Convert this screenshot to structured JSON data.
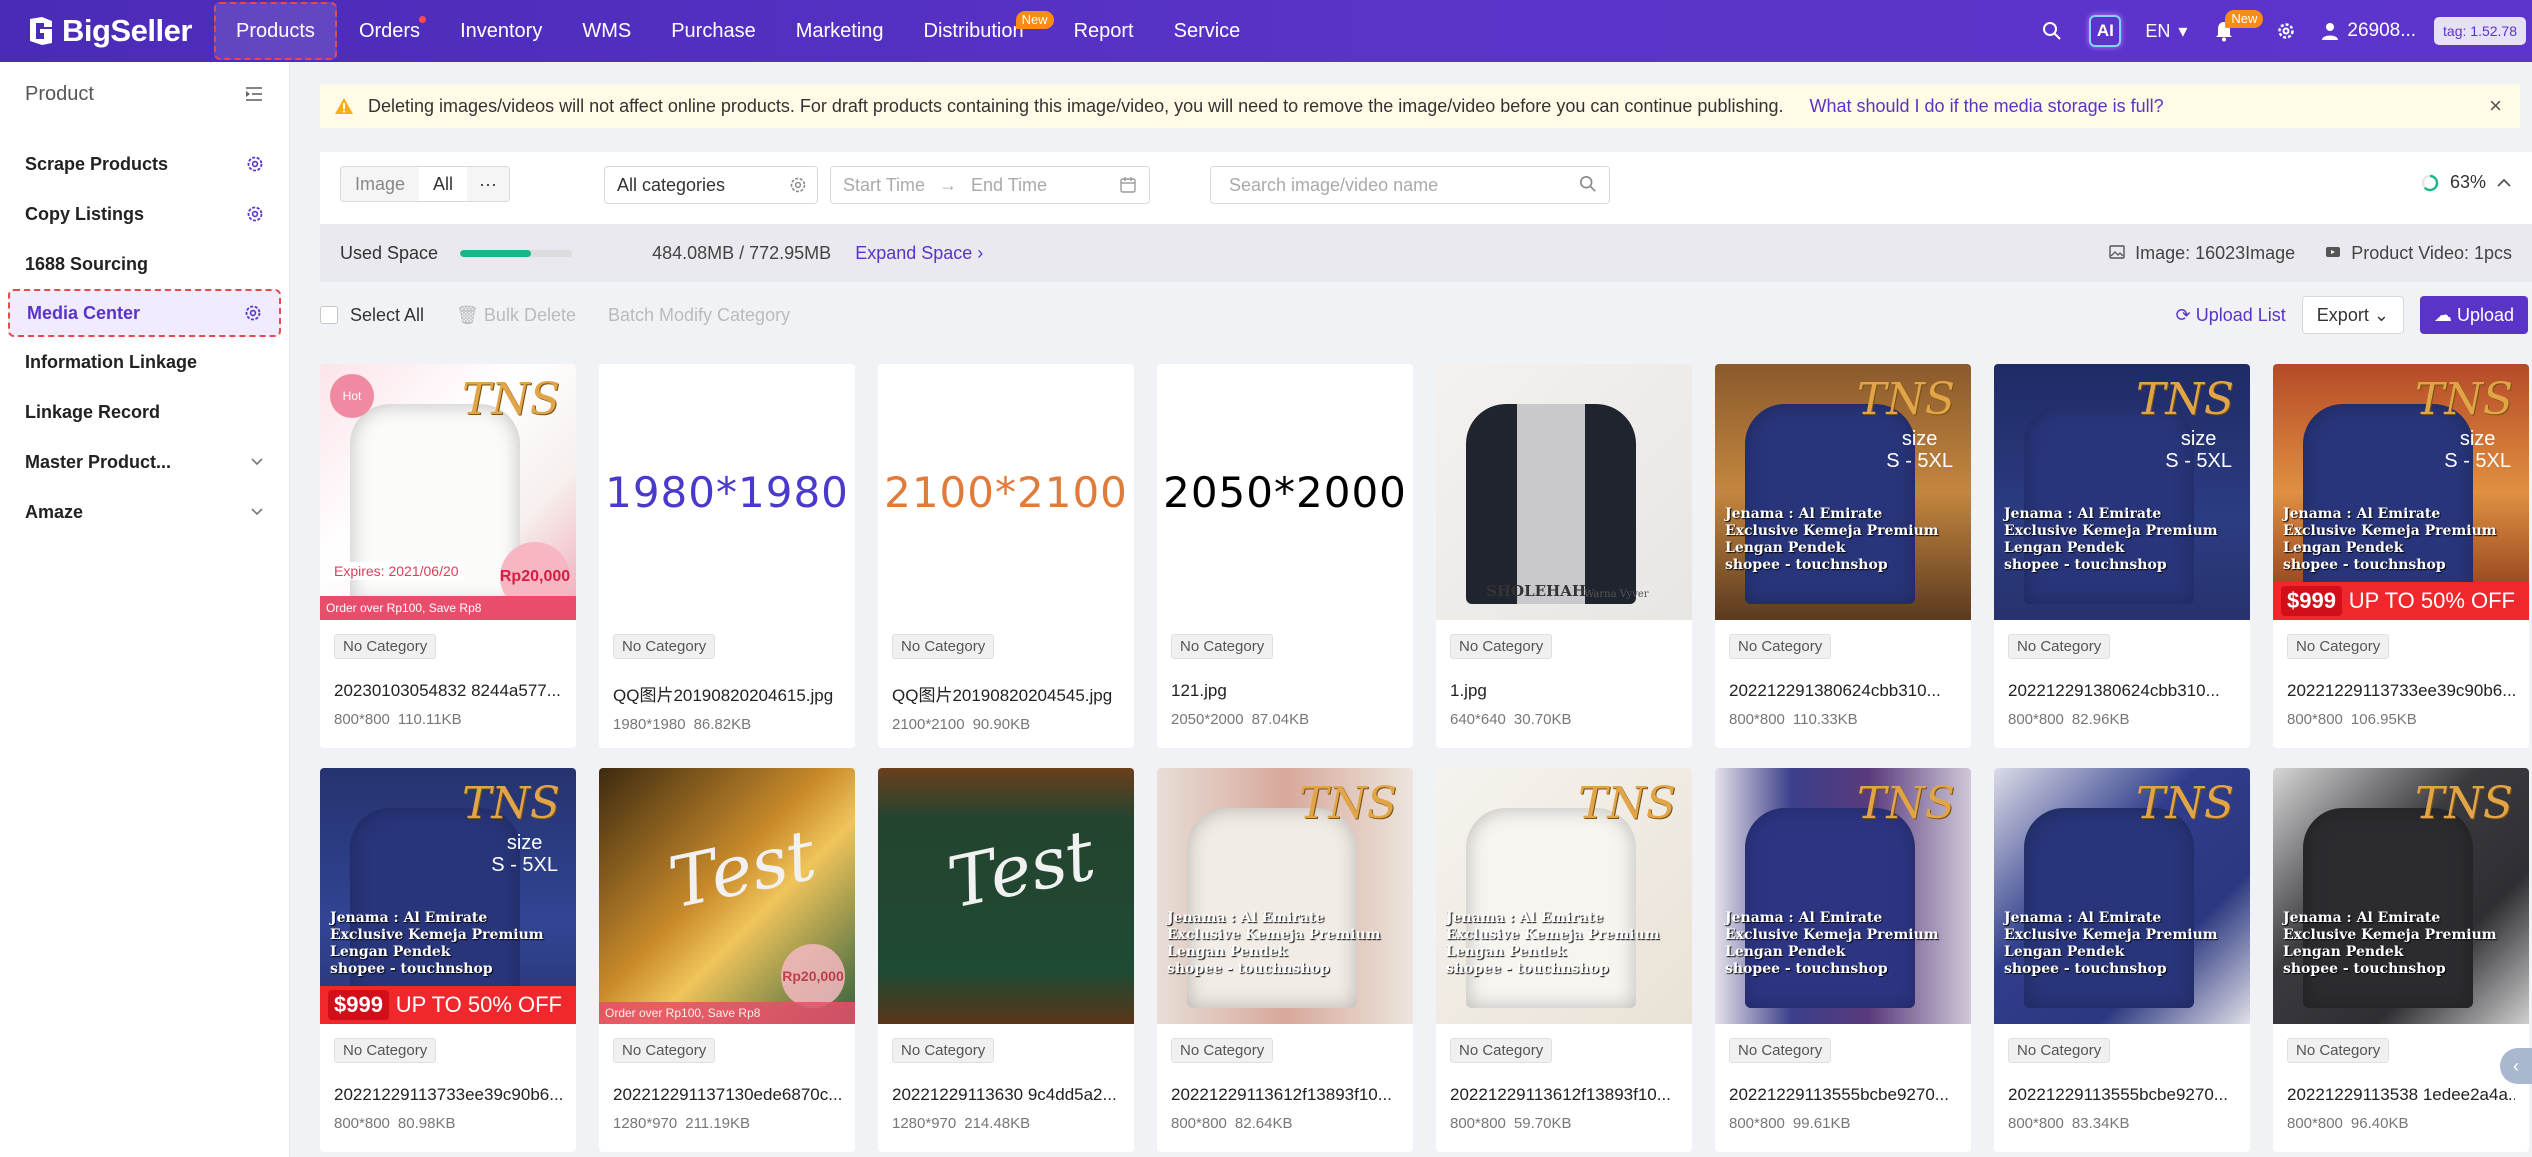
{
  "brand": {
    "name": "BigSeller"
  },
  "nav": {
    "items": [
      {
        "label": "Products"
      },
      {
        "label": "Orders"
      },
      {
        "label": "Inventory"
      },
      {
        "label": "WMS"
      },
      {
        "label": "Purchase"
      },
      {
        "label": "Marketing"
      },
      {
        "label": "Distribution",
        "badge": "New"
      },
      {
        "label": "Report"
      },
      {
        "label": "Service"
      }
    ],
    "ai_label": "AI",
    "language": "EN",
    "notifications_badge": "New",
    "user": "26908...",
    "tag": "tag: 1.52.78"
  },
  "sidebar": {
    "title": "Product",
    "items": [
      {
        "label": "Scrape Products"
      },
      {
        "label": "Copy Listings"
      },
      {
        "label": "1688 Sourcing"
      },
      {
        "label": "Media Center"
      },
      {
        "label": "Information Linkage"
      },
      {
        "label": "Linkage Record"
      },
      {
        "label": "Master Product..."
      },
      {
        "label": "Amaze"
      }
    ]
  },
  "notice": {
    "text": "Deleting images/videos will not affect online products. For draft products containing this image/video, you will need to remove the image/video before you can continue publishing.",
    "link": "What should I do if the media storage is full?"
  },
  "filters": {
    "seg_image": "Image",
    "seg_all": "All",
    "category": "All categories",
    "start_placeholder": "Start Time",
    "end_placeholder": "End Time",
    "search_placeholder": "Search image/video name",
    "progress": "63%"
  },
  "storage": {
    "label": "Used Space",
    "used_fraction": 0.63,
    "size": "484.08MB / 772.95MB",
    "expand": "Expand Space",
    "images": "Image: 16023Image",
    "videos": "Product Video: 1pcs"
  },
  "toolbar": {
    "select_all": "Select All",
    "bulk_delete": "Bulk Delete",
    "batch_modify": "Batch Modify Category",
    "upload_list": "Upload List",
    "export": "Export",
    "upload": "Upload"
  },
  "media": [
    {
      "category": "No Category",
      "name": "20230103054832 8244a577...",
      "dims": "800*800",
      "size": "110.11KB",
      "style": "promo-white"
    },
    {
      "category": "No Category",
      "name": "QQ图片20190820204615.jpg",
      "dims": "1980*1980",
      "size": "86.82KB",
      "style": "text",
      "text": "1980*1980",
      "color": "#4a3acb"
    },
    {
      "category": "No Category",
      "name": "QQ图片20190820204545.jpg",
      "dims": "2100*2100",
      "size": "90.90KB",
      "style": "text",
      "text": "2100*2100",
      "color": "#e07b39"
    },
    {
      "category": "No Category",
      "name": "121.jpg",
      "dims": "2050*2000",
      "size": "87.04KB",
      "style": "text",
      "text": "2050*2000",
      "color": "#000000"
    },
    {
      "category": "No Category",
      "name": "1.jpg",
      "dims": "640*640",
      "size": "30.70KB",
      "style": "vest"
    },
    {
      "category": "No Category",
      "name": "202212291380624cbb310...",
      "dims": "800*800",
      "size": "110.33KB",
      "style": "navy-sunset"
    },
    {
      "category": "No Category",
      "name": "202212291380624cbb310...",
      "dims": "800*800",
      "size": "82.96KB",
      "style": "navy"
    },
    {
      "category": "No Category",
      "name": "20221229113733ee39c90b6...",
      "dims": "800*800",
      "size": "106.95KB",
      "style": "navy-sale-sunset"
    },
    {
      "category": "No Category",
      "name": "20221229113733ee39c90b6...",
      "dims": "800*800",
      "size": "80.98KB",
      "style": "navy-sale"
    },
    {
      "category": "No Category",
      "name": "202212291137130ede6870c...",
      "dims": "1280*970",
      "size": "211.19KB",
      "style": "test-sunset"
    },
    {
      "category": "No Category",
      "name": "20221229113630 9c4dd5a2...",
      "dims": "1280*970",
      "size": "214.48KB",
      "style": "test-board"
    },
    {
      "category": "No Category",
      "name": "20221229113612f13893f10...",
      "dims": "800*800",
      "size": "82.64KB",
      "style": "white-pink"
    },
    {
      "category": "No Category",
      "name": "20221229113612f13893f10...",
      "dims": "800*800",
      "size": "59.70KB",
      "style": "white"
    },
    {
      "category": "No Category",
      "name": "20221229113555bcbe9270...",
      "dims": "800*800",
      "size": "99.61KB",
      "style": "navy-purple"
    },
    {
      "category": "No Category",
      "name": "20221229113555bcbe9270...",
      "dims": "800*800",
      "size": "83.34KB",
      "style": "navy-plain"
    },
    {
      "category": "No Category",
      "name": "20221229113538 1edee2a4a...",
      "dims": "800*800",
      "size": "96.40KB",
      "style": "dark"
    }
  ],
  "thumb_text": {
    "brand": "TNS",
    "size_label": "size",
    "size_range": "S - 5XL",
    "caption_1": "Jenama : Al Emirate",
    "caption_2": "shopee - touchnshop",
    "caption_3": "Exclusive Kemeja Premium Lengan Pendek",
    "sale": "UP TO 50% OFF",
    "price": "$999",
    "test": "Test",
    "hot": "Hot",
    "expires": "Expires:  2021/06/20",
    "promo_price": "Rp20,000",
    "order_note": "Order over Rp100, Save Rp8",
    "vest_label": "SHOLEHAH",
    "vest_sub": "Warna Vyver"
  }
}
